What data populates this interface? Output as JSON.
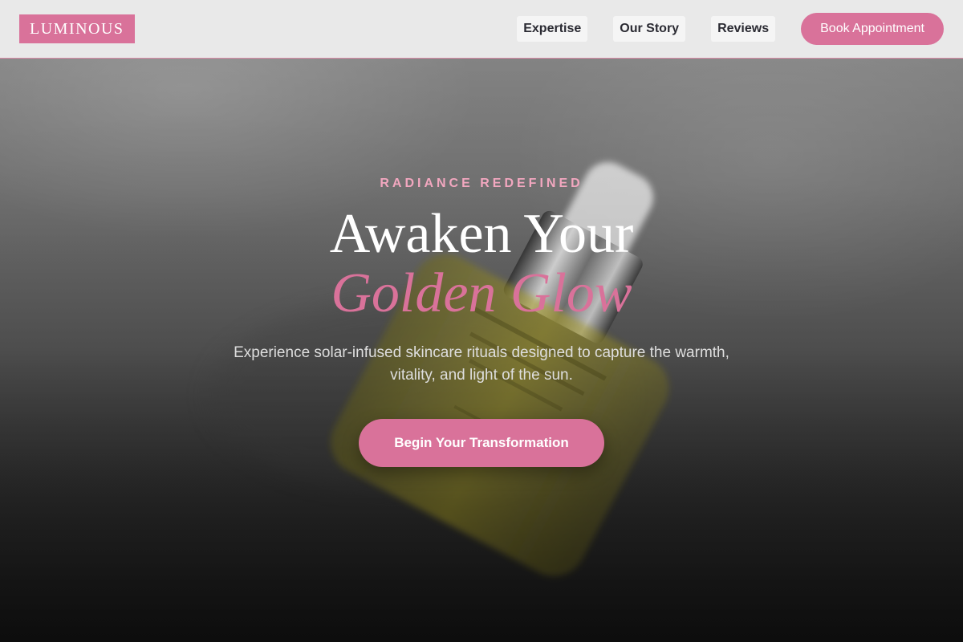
{
  "nav": {
    "logo": "LUMINOUS",
    "links": [
      "Expertise",
      "Our Story",
      "Reviews"
    ],
    "book_label": "Book Appointment"
  },
  "hero": {
    "eyebrow": "RADIANCE REDEFINED",
    "headline_line1": "Awaken Your",
    "headline_line2": "Golden Glow",
    "subtitle": "Experience solar-infused skincare rituals designed to capture the warmth, vitality, and light of the sun.",
    "cta_label": "Begin Your Transformation"
  },
  "colors": {
    "accent": "#d9729a",
    "eyebrow": "#f2a7bf",
    "nav_bg": "#e9e9e9"
  }
}
